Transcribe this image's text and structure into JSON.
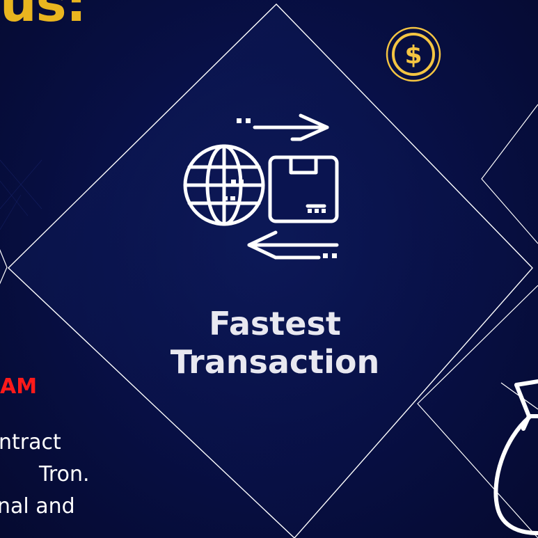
{
  "heading": {
    "text": "us:"
  },
  "left_panel": {
    "title": "AM",
    "lines": [
      "ntract",
      "Tron.",
      "nal and"
    ]
  },
  "center_card": {
    "title": "Fastest Transaction",
    "icon": "global-shipping-icon"
  },
  "coin_badge": {
    "symbol": "$",
    "icon": "dollar-coin-icon"
  },
  "right_card": {
    "icon": "money-bag-icon"
  },
  "colors": {
    "background": "#081047",
    "heading": "#e9b51f",
    "accent_red": "#ff1a1a",
    "coin_gold": "#f5c542",
    "text": "#ffffff"
  }
}
